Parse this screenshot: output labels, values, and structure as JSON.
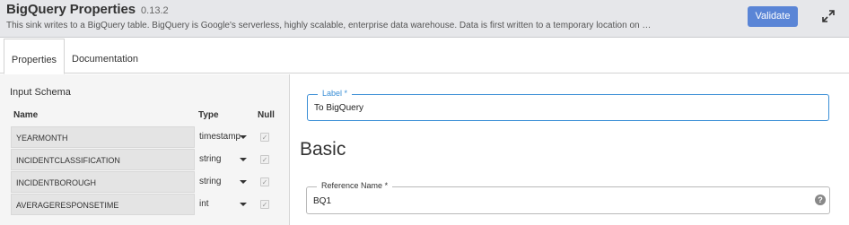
{
  "header": {
    "title": "BigQuery Properties",
    "version": "0.13.2",
    "description": "This sink writes to a BigQuery table. BigQuery is Google's serverless, highly scalable, enterprise data warehouse. Data is first written to a temporary location on Google Cloud Stor...",
    "validate_label": "Validate",
    "expand_icon": "expand-icon"
  },
  "tabs": [
    {
      "label": "Properties",
      "active": true
    },
    {
      "label": "Documentation",
      "active": false
    }
  ],
  "schema": {
    "title": "Input Schema",
    "columns": {
      "name": "Name",
      "type": "Type",
      "null": "Null"
    },
    "rows": [
      {
        "name": "YEARMONTH",
        "type": "timestamp",
        "nullable": true
      },
      {
        "name": "INCIDENTCLASSIFICATION",
        "type": "string",
        "nullable": true
      },
      {
        "name": "INCIDENTBOROUGH",
        "type": "string",
        "nullable": true
      },
      {
        "name": "AVERAGERESPONSETIME",
        "type": "int",
        "nullable": true
      }
    ]
  },
  "form": {
    "label_field": {
      "label": "Label",
      "required_mark": "*",
      "value": "To BigQuery"
    },
    "section_title": "Basic",
    "reference_field": {
      "label": "Reference Name",
      "required_mark": "*",
      "value": "BQ1",
      "help_icon": "help-icon"
    }
  },
  "colors": {
    "accent": "#5a85d6",
    "focus": "#3a8ed6",
    "header_bg": "#e6e7ea",
    "panel_bg": "#f5f5f5"
  }
}
